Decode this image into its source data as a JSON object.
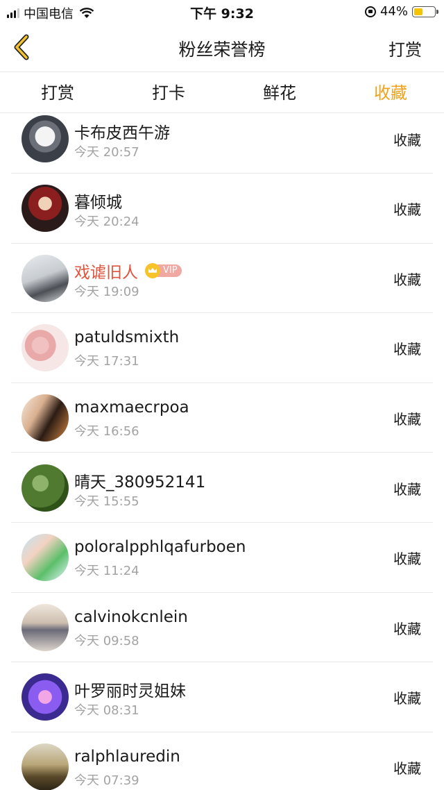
{
  "status_bar": {
    "carrier": "中国电信",
    "time": "下午 9:32",
    "battery": "44%",
    "battery_level": 0.44,
    "battery_color": "#f5c400"
  },
  "nav": {
    "back_icon": "chevron-left-icon",
    "title": "粉丝荣誉榜",
    "action": "打赏",
    "accent": "#f0a21b"
  },
  "tabs": [
    {
      "label": "打赏",
      "active": false
    },
    {
      "label": "打卡",
      "active": false
    },
    {
      "label": "鲜花",
      "active": false
    },
    {
      "label": "收藏",
      "active": true
    }
  ],
  "list": [
    {
      "name": "卡布皮西午游",
      "time": "今天 20:57",
      "action": "收藏",
      "vip": false
    },
    {
      "name": "暮倾城",
      "time": "今天 20:24",
      "action": "收藏",
      "vip": false
    },
    {
      "name": "戏谑旧人",
      "time": "今天 19:09",
      "action": "收藏",
      "vip": true,
      "vip_label": "VIP"
    },
    {
      "name": "patuldsmixth",
      "time": "今天 17:31",
      "action": "收藏",
      "vip": false
    },
    {
      "name": "maxmaecrpoa",
      "time": "今天 16:56",
      "action": "收藏",
      "vip": false
    },
    {
      "name": "晴天_380952141",
      "time": "今天 15:55",
      "action": "收藏",
      "vip": false
    },
    {
      "name": "poloralpphlqafurboen",
      "time": "今天 11:24",
      "action": "收藏",
      "vip": false
    },
    {
      "name": "calvinokcnlein",
      "time": "今天 09:58",
      "action": "收藏",
      "vip": false
    },
    {
      "name": "叶罗丽时灵姐妹",
      "time": "今天 08:31",
      "action": "收藏",
      "vip": false
    },
    {
      "name": "ralphlauredin",
      "time": "今天 07:39",
      "action": "收藏",
      "vip": false
    }
  ]
}
